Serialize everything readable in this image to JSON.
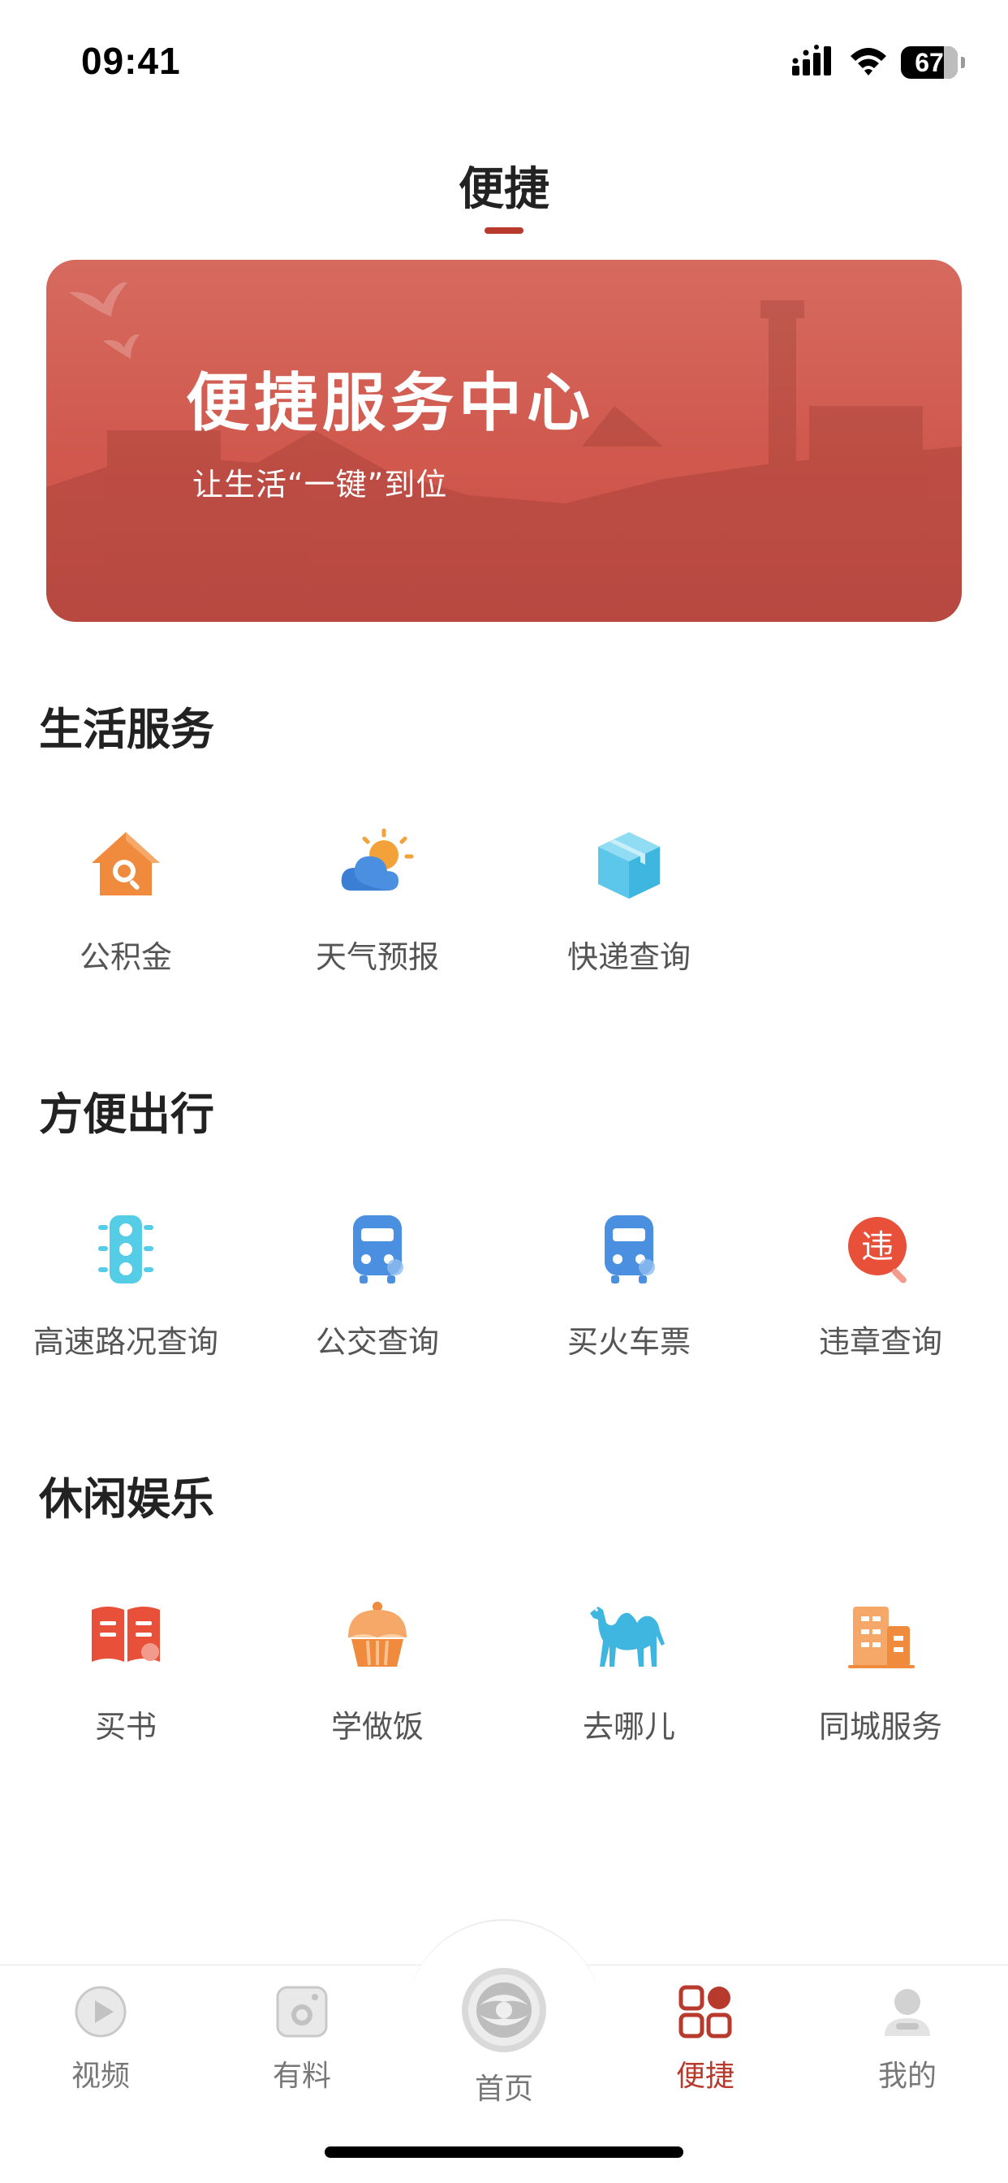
{
  "status_bar": {
    "time": "09:41",
    "battery": "67"
  },
  "header": {
    "title": "便捷"
  },
  "banner": {
    "title": "便捷服务中心",
    "subtitle": "让生活“一键”到位"
  },
  "sections": [
    {
      "title": "生活服务",
      "items": [
        {
          "label": "公积金",
          "icon": "house-search-icon"
        },
        {
          "label": "天气预报",
          "icon": "weather-icon"
        },
        {
          "label": "快递查询",
          "icon": "package-icon"
        }
      ]
    },
    {
      "title": "方便出行",
      "items": [
        {
          "label": "高速路况查询",
          "icon": "traffic-light-icon"
        },
        {
          "label": "公交查询",
          "icon": "bus-icon"
        },
        {
          "label": "买火车票",
          "icon": "train-icon"
        },
        {
          "label": "违章查询",
          "icon": "violation-search-icon"
        }
      ]
    },
    {
      "title": "休闲娱乐",
      "items": [
        {
          "label": "买书",
          "icon": "book-icon"
        },
        {
          "label": "学做饭",
          "icon": "cupcake-icon"
        },
        {
          "label": "去哪儿",
          "icon": "camel-icon"
        },
        {
          "label": "同城服务",
          "icon": "building-icon"
        }
      ]
    }
  ],
  "violation_icon_char": "违",
  "tabbar": [
    {
      "label": "视频",
      "icon": "play-icon",
      "active": false
    },
    {
      "label": "有料",
      "icon": "camera-icon",
      "active": false
    },
    {
      "label": "首页",
      "icon": "home-logo-icon",
      "active": false
    },
    {
      "label": "便捷",
      "icon": "apps-grid-icon",
      "active": true
    },
    {
      "label": "我的",
      "icon": "profile-icon",
      "active": false
    }
  ],
  "colors": {
    "accent": "#b83a2d",
    "banner": "#d35f54",
    "label": "#555555",
    "inactive_tab": "#777777"
  }
}
